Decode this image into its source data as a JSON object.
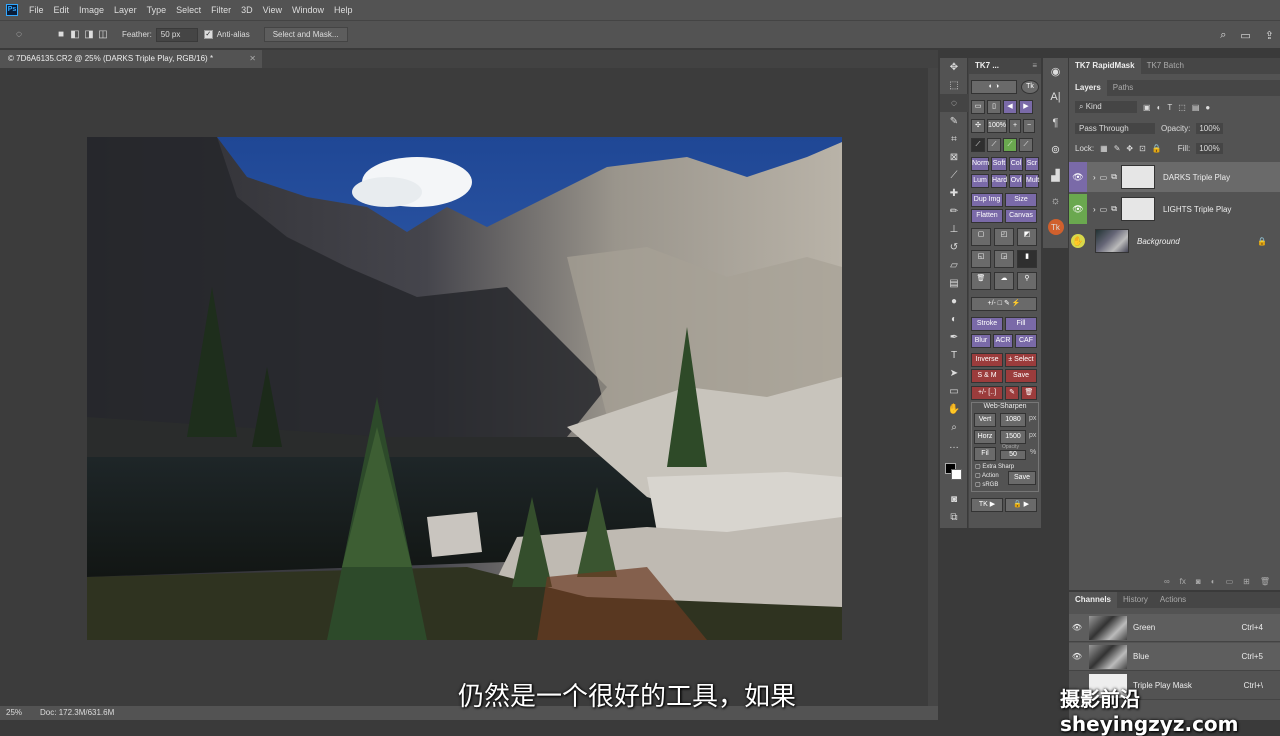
{
  "menubar": {
    "logo": "Ps",
    "items": [
      "File",
      "Edit",
      "Image",
      "Layer",
      "Type",
      "Select",
      "Filter",
      "3D",
      "View",
      "Window",
      "Help"
    ]
  },
  "options": {
    "feather_label": "Feather:",
    "feather_value": "50 px",
    "antialias_label": "Anti-alias",
    "select_mask_label": "Select and Mask..."
  },
  "document": {
    "tab_title": "© 7D6A6135.CR2 @ 25% (DARKS Triple Play, RGB/16) *",
    "zoom": "25%",
    "doc_size": "Doc: 172.3M/631.6M"
  },
  "subtitle": "仍然是一个很好的工具，如果",
  "watermark": "摄影前沿 sheyingzyz.com",
  "tk_panel": {
    "title": "TK7 ...",
    "buttons": {
      "pct": "100%",
      "norm": "Norm",
      "soft": "Soft",
      "col": "Col",
      "scr": "Scr",
      "lum": "Lum",
      "hard": "Hard",
      "ovl": "Ovl",
      "mult": "Mult",
      "dup_img": "Dup Img",
      "size": "Size",
      "flatten": "Flatten",
      "canvas": "Canvas",
      "stroke": "Stroke",
      "fill": "Fill",
      "blur": "Blur",
      "acr": "ACR",
      "caf": "CAF",
      "inverse": "Inverse",
      "pm_select": "± Select",
      "sm": "S & M",
      "save": "Save",
      "web_sharpen": "Web-Sharpen",
      "vert": "Vert",
      "vert_val": "1080",
      "px1": "px",
      "horz": "Horz",
      "horz_val": "1500",
      "px2": "px",
      "fill2": "Fil",
      "opacity_lbl": "Opacity",
      "opacity_val": "50",
      "pct_sign": "%",
      "extra_sharp": "Extra Sharp",
      "action": "Action",
      "srgb": "sRGB",
      "save2": "Save",
      "tk_play": "TK ▶"
    }
  },
  "layers_panel": {
    "tabs": [
      "TK7 RapidMask",
      "TK7 Batch"
    ],
    "sub_tabs": [
      "Layers",
      "Paths"
    ],
    "kind": "Kind",
    "blend_mode": "Pass Through",
    "opacity_label": "Opacity:",
    "opacity_value": "100%",
    "lock_label": "Lock:",
    "fill_label": "Fill:",
    "fill_value": "100%",
    "layers": [
      {
        "name": "DARKS Triple Play"
      },
      {
        "name": "LIGHTS Triple Play"
      },
      {
        "name": "Background"
      }
    ]
  },
  "channels_panel": {
    "tabs": [
      "Channels",
      "History",
      "Actions"
    ],
    "rows": [
      {
        "name": "Green",
        "shortcut": "Ctrl+4"
      },
      {
        "name": "Blue",
        "shortcut": "Ctrl+5"
      },
      {
        "name": "Triple Play Mask",
        "shortcut": "Ctrl+\\"
      }
    ]
  },
  "colors": {
    "accent_purple": "#7a6aa8",
    "accent_green": "#6aa84f",
    "sky": "#2d55a8"
  }
}
